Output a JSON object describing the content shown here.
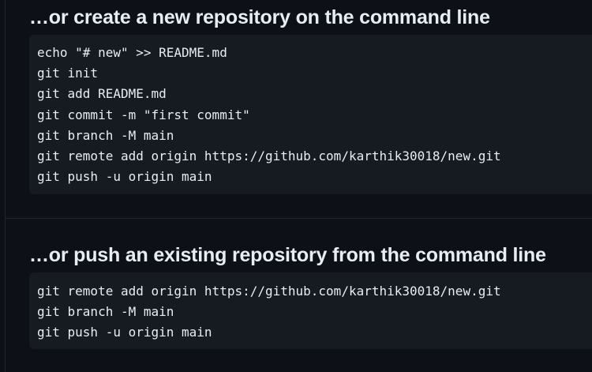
{
  "create_section": {
    "title": "…or create a new repository on the command line",
    "lines": [
      "echo \"# new\" >> README.md",
      "git init",
      "git add README.md",
      "git commit -m \"first commit\"",
      "git branch -M main",
      "git remote add origin https://github.com/karthik30018/new.git",
      "git push -u origin main"
    ]
  },
  "push_section": {
    "title": "…or push an existing repository from the command line",
    "lines": [
      "git remote add origin https://github.com/karthik30018/new.git",
      "git branch -M main",
      "git push -u origin main"
    ]
  },
  "colors": {
    "background": "#0d1117",
    "code_background": "#161b22",
    "text": "#e6edf3",
    "divider": "#21262d"
  }
}
